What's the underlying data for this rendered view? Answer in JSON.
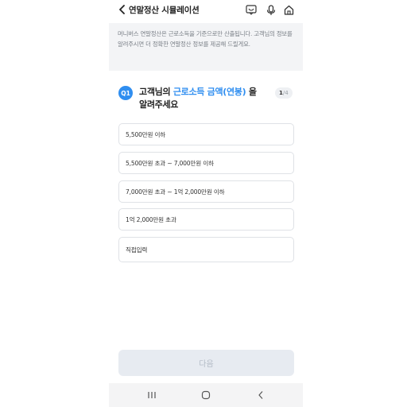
{
  "header": {
    "title": "연말정산 시뮬레이션",
    "icons": [
      "back-icon",
      "chatbot-icon",
      "mic-icon",
      "home-icon"
    ]
  },
  "notice": {
    "text": "머니버스 연말정산은 근로소득을 기준으로만 산출됩니다. 고객님의 정보를 알려주시면 더 정확한 연말정산 정보를 제공해 드릴게요."
  },
  "question": {
    "badge": "Q1",
    "prefix": "고객님의 ",
    "highlight": "근로소득 금액(연봉)",
    "suffix": " 을",
    "line2": "알려주세요",
    "progress_current": "1",
    "progress_total": "/4"
  },
  "options": [
    "5,500만원 이하",
    "5,500만원 초과 ~ 7,000만원 이하",
    "7,000만원 초과 ~ 1억 2,000만원 이하",
    "1억 2,000만원 초과",
    "직접입력"
  ],
  "next_button": {
    "label": "다음",
    "enabled": false
  },
  "colors": {
    "accent": "#2f8ef0",
    "notice_bg": "#f3f4f6",
    "disabled_btn": "#e7ebf1"
  },
  "navbar": {
    "icons": [
      "recent-apps-icon",
      "home-nav-icon",
      "back-nav-icon"
    ]
  }
}
